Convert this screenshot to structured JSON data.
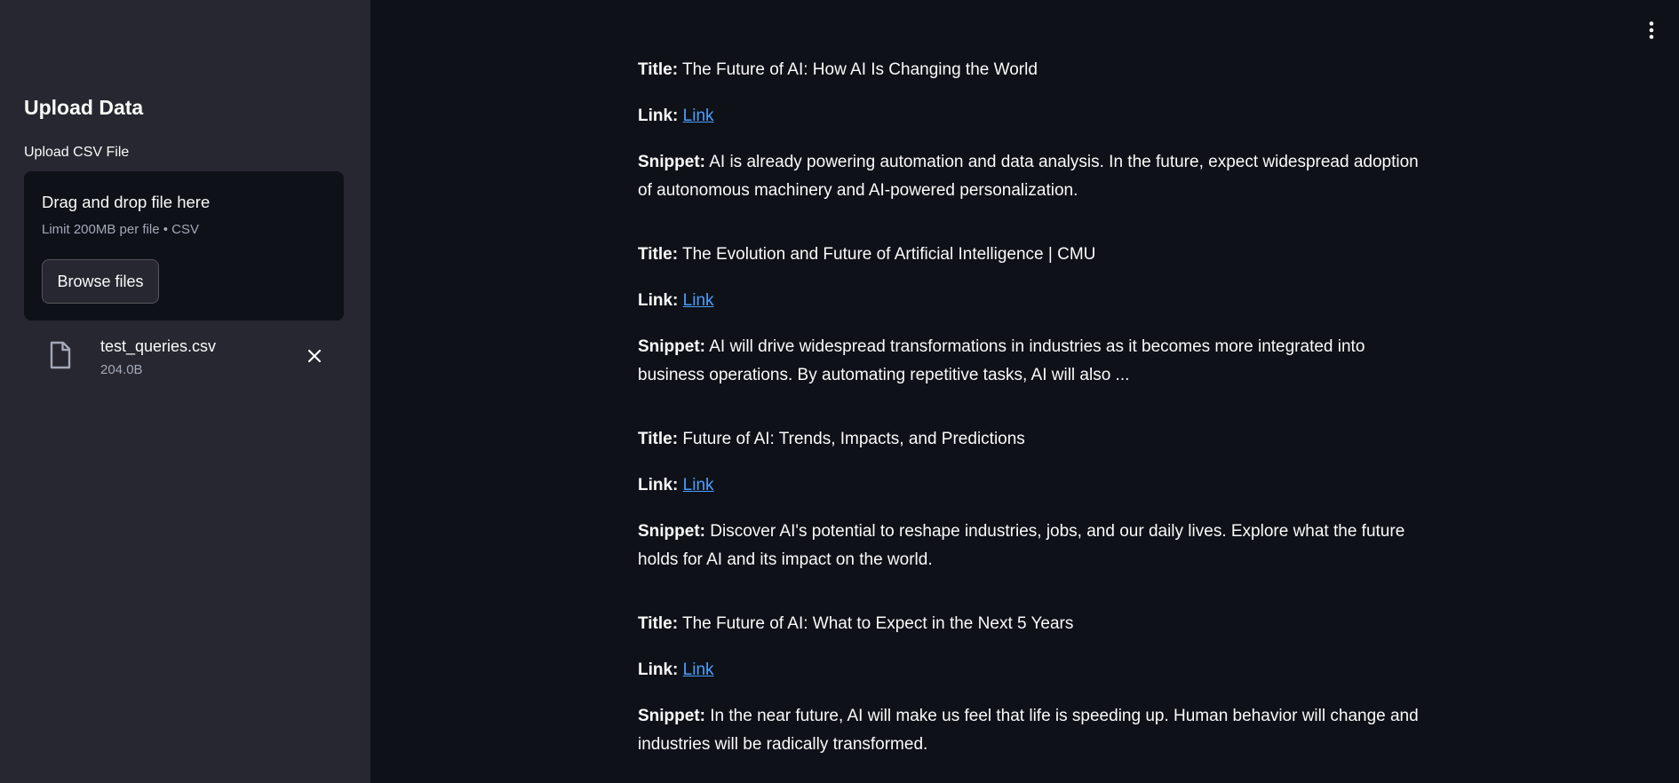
{
  "sidebar": {
    "title": "Upload Data",
    "upload_label": "Upload CSV File",
    "dropzone": {
      "title": "Drag and drop file here",
      "limit": "Limit 200MB per file • CSV",
      "browse_label": "Browse files"
    },
    "file": {
      "name": "test_queries.csv",
      "size": "204.0B",
      "icon": "file-icon",
      "remove_icon": "close-icon"
    }
  },
  "header": {
    "menu_icon": "kebab-menu-icon"
  },
  "colors": {
    "background": "#0e1117",
    "sidebar": "#262730",
    "link": "#4b9eff",
    "text": "#fafafa",
    "muted": "#a3a8b8"
  },
  "results": [
    {
      "title_label": "Title:",
      "title": "The Future of AI: How AI Is Changing the World",
      "link_label": "Link:",
      "link_text": "Link",
      "snippet_label": "Snippet:",
      "snippet": "AI is already powering automation and data analysis. In the future, expect widespread adoption of autonomous machinery and AI-powered personalization."
    },
    {
      "title_label": "Title:",
      "title": "The Evolution and Future of Artificial Intelligence | CMU",
      "link_label": "Link:",
      "link_text": "Link",
      "snippet_label": "Snippet:",
      "snippet": "AI will drive widespread transformations in industries as it becomes more integrated into business operations. By automating repetitive tasks, AI will also ..."
    },
    {
      "title_label": "Title:",
      "title": "Future of AI: Trends, Impacts, and Predictions",
      "link_label": "Link:",
      "link_text": "Link",
      "snippet_label": "Snippet:",
      "snippet": "Discover AI's potential to reshape industries, jobs, and our daily lives. Explore what the future holds for AI and its impact on the world."
    },
    {
      "title_label": "Title:",
      "title": "The Future of AI: What to Expect in the Next 5 Years",
      "link_label": "Link:",
      "link_text": "Link",
      "snippet_label": "Snippet:",
      "snippet": "In the near future, AI will make us feel that life is speeding up. Human behavior will change and industries will be radically transformed."
    }
  ]
}
